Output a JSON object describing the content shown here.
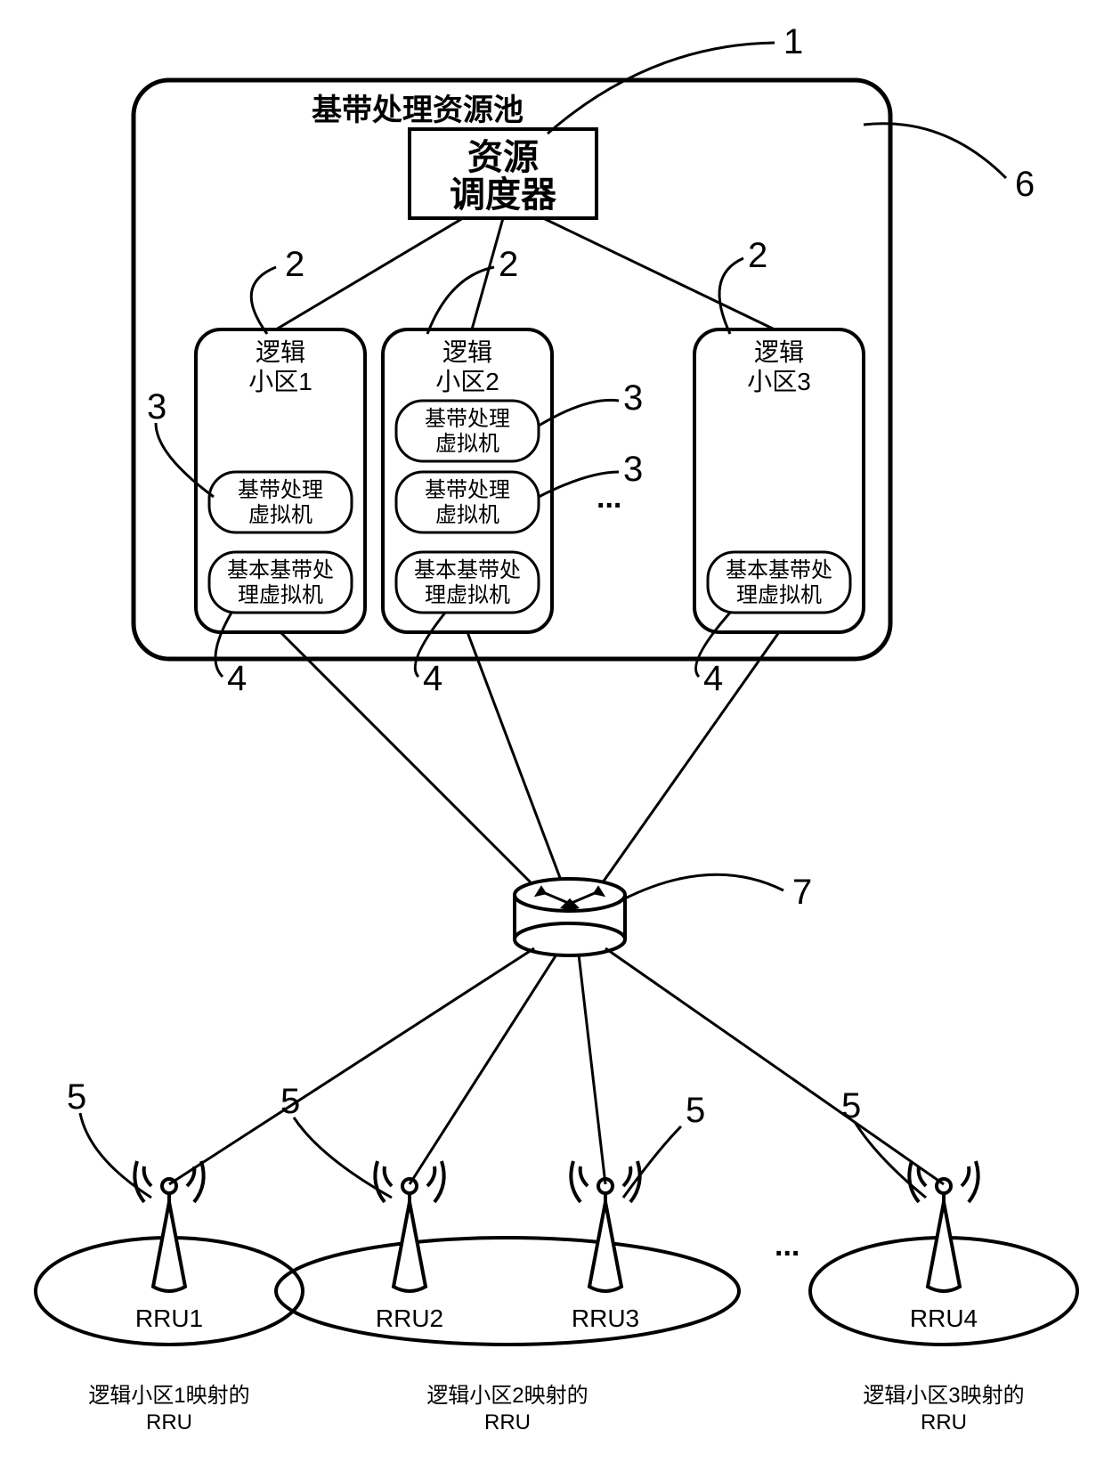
{
  "callouts": {
    "c1": "1",
    "c2": "2",
    "c3": "3",
    "c4": "4",
    "c5": "5",
    "c6": "6",
    "c7": "7"
  },
  "pool": {
    "title": "基带处理资源池",
    "scheduler_line1": "资源",
    "scheduler_line2": "调度器",
    "cells": [
      {
        "title_line1": "逻辑",
        "title_line2": "小区1",
        "vm_line1": "基带处理",
        "vm_line2": "虚拟机",
        "basic_line1": "基本基带处",
        "basic_line2": "理虚拟机"
      },
      {
        "title_line1": "逻辑",
        "title_line2": "小区2",
        "vm_line1": "基带处理",
        "vm_line2": "虚拟机",
        "basic_line1": "基本基带处",
        "basic_line2": "理虚拟机"
      },
      {
        "title_line1": "逻辑",
        "title_line2": "小区3",
        "basic_line1": "基本基带处",
        "basic_line2": "理虚拟机"
      }
    ],
    "ellipsis": "..."
  },
  "rrus": [
    {
      "label": "RRU1",
      "caption_line1": "逻辑小区1映射的",
      "caption_line2": "RRU"
    },
    {
      "label": "RRU2",
      "caption_line1": "逻辑小区2映射的",
      "caption_line2": "RRU"
    },
    {
      "label": "RRU3"
    },
    {
      "label": "RRU4",
      "caption_line1": "逻辑小区3映射的",
      "caption_line2": "RRU"
    }
  ],
  "rru_ellipsis": "..."
}
